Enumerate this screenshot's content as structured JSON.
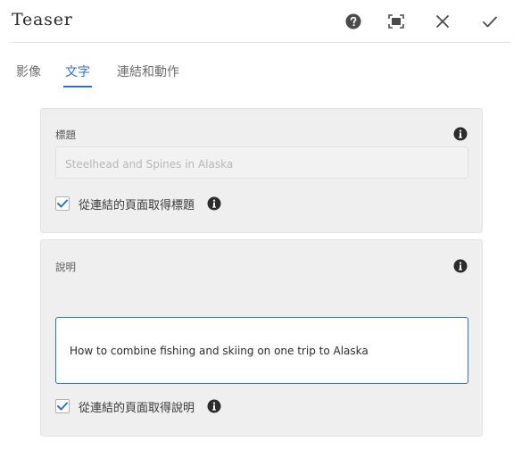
{
  "dialog": {
    "title": "Teaser",
    "icons": {
      "help": "help-icon",
      "fullscreen": "fullscreen-icon",
      "close": "close-icon",
      "done": "checkmark-icon"
    }
  },
  "tabs": [
    {
      "label": "影像",
      "active": false
    },
    {
      "label": "文字",
      "active": true
    },
    {
      "label": "連結和動作",
      "active": false
    }
  ],
  "title_section": {
    "label": "標題",
    "value": "Steelhead and Spines in Alaska",
    "checkbox_label": "從連結的頁面取得標題",
    "checked": true
  },
  "description_section": {
    "label": "說明",
    "value": "How to combine fishing and skiing on one trip to Alaska",
    "checkbox_label": "從連結的頁面取得說明",
    "checked": true
  },
  "colors": {
    "accent": "#2c6fd6",
    "panel_bg": "#efefef"
  }
}
